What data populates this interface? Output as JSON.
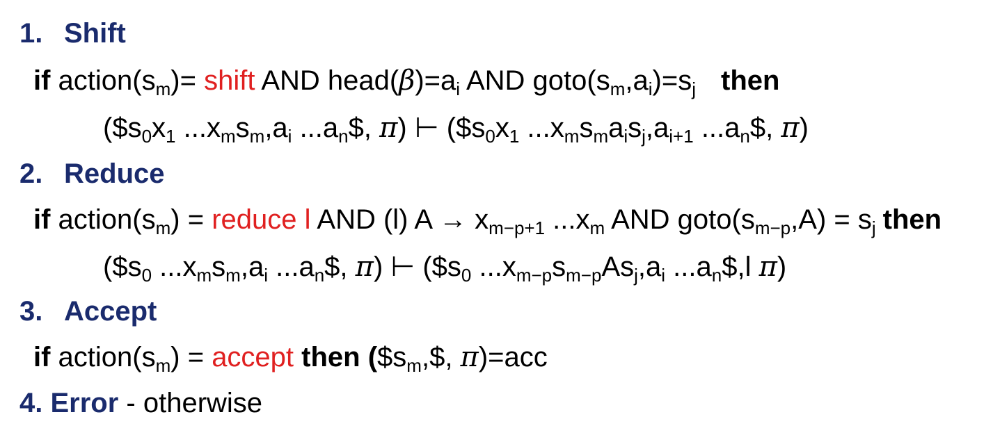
{
  "sections": [
    {
      "number": "1.",
      "title": "Shift",
      "condition": {
        "if": "if",
        "action_open": " action(s",
        "sub_m": "m",
        "action_close": ")= ",
        "keyword": "shift",
        "and1": " AND head(",
        "beta": "β",
        "head_eq": ")=a",
        "sub_i": "i",
        "and2": " AND goto(s",
        "sub_m2": "m",
        "comma_a": ",a",
        "sub_i2": "i",
        "eq_s": ")=s",
        "sub_j": "j",
        "then": "then"
      },
      "transition": {
        "p1": "($s",
        "s0": "0",
        "x": "x",
        "x1": "1",
        "dots1": " ...x",
        "xm": "m",
        "s_a": "s",
        "sm": "m",
        "comma_a": ",a",
        "ai": "i",
        "dots2": " ...a",
        "an": "n",
        "end1": "$, ",
        "pi": "π",
        "turnstile": ") ⊢ ($s",
        "s0b": "0",
        "xb": "x",
        "x1b": "1",
        "dots3": " ...x",
        "xmb": "m",
        "sb": "s",
        "smb": "m",
        "ab": "a",
        "aib": "i",
        "sj_s": "s",
        "sj": "j",
        "comma_a2": ",a",
        "ai1": "i+1",
        "dots4": " ...a",
        "an2": "n",
        "end2": "$, ",
        "pi2": "π",
        "close": ")"
      }
    },
    {
      "number": "2.",
      "title": "Reduce",
      "condition": {
        "if": "if",
        "action_open": " action(s",
        "sub_m": "m",
        "action_close": ") = ",
        "keyword": "reduce l",
        "rule": " AND (l) A → x",
        "sub_mp1": "m−p+1",
        "dots": " ...x",
        "sub_m2": "m",
        "and2": " AND goto(s",
        "sub_mp": "m−p",
        "goto_a": ",A) = s",
        "sub_j": "j",
        "then": "then"
      },
      "transition": {
        "p1": "($s",
        "s0": "0",
        "dots1": " ...x",
        "xm": "m",
        "s_a": "s",
        "sm": "m",
        "comma_a": ",a",
        "ai": "i",
        "dots2": " ...a",
        "an": "n",
        "end1": "$, ",
        "pi": "π",
        "turnstile": ") ⊢ ($s",
        "s0b": "0",
        "dots3": " ...x",
        "xmp": "m−p",
        "sb": "s",
        "smp": "m−p",
        "as": "As",
        "sj": "j",
        "comma_a2": ",a",
        "ai2": "i",
        "dots4": " ...a",
        "an2": "n",
        "end2": "$,l ",
        "pi2": "π",
        "close": ")"
      }
    },
    {
      "number": "3.",
      "title": "Accept",
      "condition": {
        "if": "if",
        "action_open": " action(s",
        "sub_m": "m",
        "action_close": ") = ",
        "keyword": "accept",
        "then_open": " then (",
        "s_open": "$s",
        "sub_m2": "m",
        "comma": ",$, ",
        "pi": "π",
        "acc": ")=acc"
      }
    },
    {
      "number": "4.",
      "title": "Error",
      "rest": " - otherwise"
    }
  ]
}
